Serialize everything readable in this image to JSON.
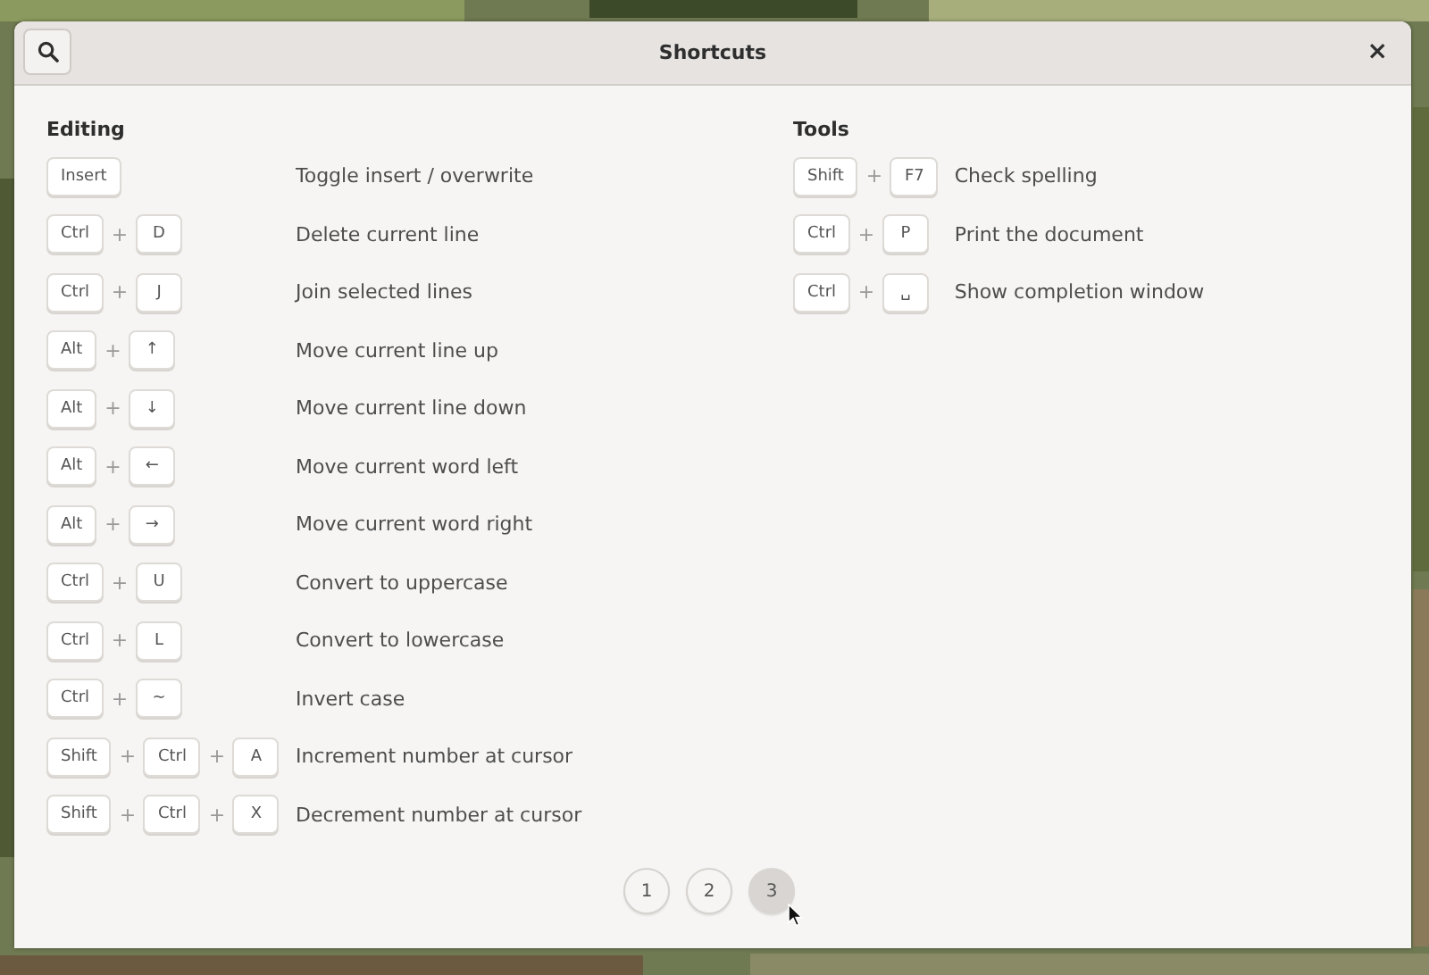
{
  "window": {
    "title": "Shortcuts",
    "close": "×"
  },
  "sections": [
    {
      "title": "Editing",
      "shortcuts": [
        {
          "parts": [
            {
              "kind": "key",
              "text": "Insert"
            }
          ],
          "description": "Toggle insert / overwrite"
        },
        {
          "parts": [
            {
              "kind": "key",
              "text": "Ctrl"
            },
            {
              "kind": "plus",
              "text": "+"
            },
            {
              "kind": "key",
              "text": "D"
            }
          ],
          "description": "Delete current line"
        },
        {
          "parts": [
            {
              "kind": "key",
              "text": "Ctrl"
            },
            {
              "kind": "plus",
              "text": "+"
            },
            {
              "kind": "key",
              "text": "J"
            }
          ],
          "description": "Join selected lines"
        },
        {
          "parts": [
            {
              "kind": "key",
              "text": "Alt"
            },
            {
              "kind": "plus",
              "text": "+"
            },
            {
              "kind": "key",
              "text": "↑"
            }
          ],
          "description": "Move current line up"
        },
        {
          "parts": [
            {
              "kind": "key",
              "text": "Alt"
            },
            {
              "kind": "plus",
              "text": "+"
            },
            {
              "kind": "key",
              "text": "↓"
            }
          ],
          "description": "Move current line down"
        },
        {
          "parts": [
            {
              "kind": "key",
              "text": "Alt"
            },
            {
              "kind": "plus",
              "text": "+"
            },
            {
              "kind": "key",
              "text": "←"
            }
          ],
          "description": "Move current word left"
        },
        {
          "parts": [
            {
              "kind": "key",
              "text": "Alt"
            },
            {
              "kind": "plus",
              "text": "+"
            },
            {
              "kind": "key",
              "text": "→"
            }
          ],
          "description": "Move current word right"
        },
        {
          "parts": [
            {
              "kind": "key",
              "text": "Ctrl"
            },
            {
              "kind": "plus",
              "text": "+"
            },
            {
              "kind": "key",
              "text": "U"
            }
          ],
          "description": "Convert to uppercase"
        },
        {
          "parts": [
            {
              "kind": "key",
              "text": "Ctrl"
            },
            {
              "kind": "plus",
              "text": "+"
            },
            {
              "kind": "key",
              "text": "L"
            }
          ],
          "description": "Convert to lowercase"
        },
        {
          "parts": [
            {
              "kind": "key",
              "text": "Ctrl"
            },
            {
              "kind": "plus",
              "text": "+"
            },
            {
              "kind": "key",
              "text": "~"
            }
          ],
          "description": "Invert case"
        },
        {
          "parts": [
            {
              "kind": "key",
              "text": "Shift"
            },
            {
              "kind": "plus",
              "text": "+"
            },
            {
              "kind": "key",
              "text": "Ctrl"
            },
            {
              "kind": "plus",
              "text": "+"
            },
            {
              "kind": "key",
              "text": "A"
            }
          ],
          "description": "Increment number at cursor"
        },
        {
          "parts": [
            {
              "kind": "key",
              "text": "Shift"
            },
            {
              "kind": "plus",
              "text": "+"
            },
            {
              "kind": "key",
              "text": "Ctrl"
            },
            {
              "kind": "plus",
              "text": "+"
            },
            {
              "kind": "key",
              "text": "X"
            }
          ],
          "description": "Decrement number at cursor"
        }
      ]
    },
    {
      "title": "Tools",
      "shortcuts": [
        {
          "parts": [
            {
              "kind": "key",
              "text": "Shift"
            },
            {
              "kind": "plus",
              "text": "+"
            },
            {
              "kind": "key",
              "text": "F7"
            }
          ],
          "description": "Check spelling"
        },
        {
          "parts": [
            {
              "kind": "key",
              "text": "Ctrl"
            },
            {
              "kind": "plus",
              "text": "+"
            },
            {
              "kind": "key",
              "text": "P"
            }
          ],
          "description": "Print the document"
        },
        {
          "parts": [
            {
              "kind": "key",
              "text": "Ctrl"
            },
            {
              "kind": "plus",
              "text": "+"
            },
            {
              "kind": "key",
              "text": "␣"
            }
          ],
          "description": "Show completion window"
        }
      ]
    }
  ],
  "pages": [
    {
      "label": "1",
      "selected": false
    },
    {
      "label": "2",
      "selected": false
    },
    {
      "label": "3",
      "selected": true
    }
  ]
}
